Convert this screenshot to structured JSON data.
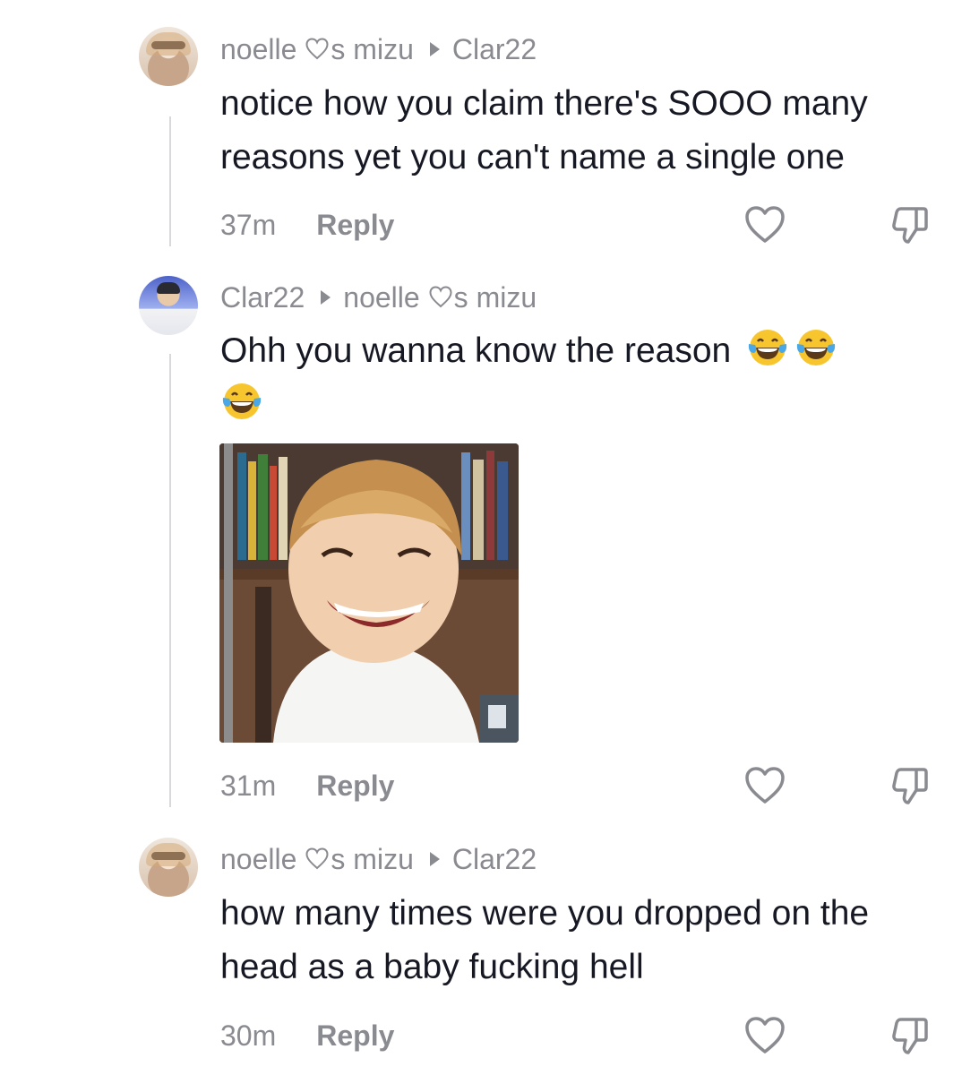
{
  "comments": [
    {
      "author": "noelle",
      "author_suffix": "s mizu",
      "reply_to": "Clar22",
      "text": "notice how you claim there's SOOO many reasons yet you can't name a single one",
      "time": "37m",
      "reply_label": "Reply"
    },
    {
      "author": "Clar22",
      "reply_to": "noelle",
      "reply_to_suffix": "s mizu",
      "text": "Ohh you wanna know the reason",
      "time": "31m",
      "reply_label": "Reply"
    },
    {
      "author": "noelle",
      "author_suffix": "s mizu",
      "reply_to": "Clar22",
      "text": "how many times were you dropped on the head as a baby fucking hell",
      "time": "30m",
      "reply_label": "Reply"
    }
  ],
  "icons": {
    "heart_outline": "heart-icon",
    "thumbs_down": "dislike-icon",
    "laughing_emoji": "face-with-tears-of-joy-emoji",
    "reply_arrow": "play-triangle-icon"
  },
  "colors": {
    "text_primary": "#161823",
    "text_secondary": "#8a8b91",
    "thread_line": "#d9d9dc",
    "emoji_yellow": "#f7c62f",
    "emoji_tear": "#4aa8e8"
  }
}
